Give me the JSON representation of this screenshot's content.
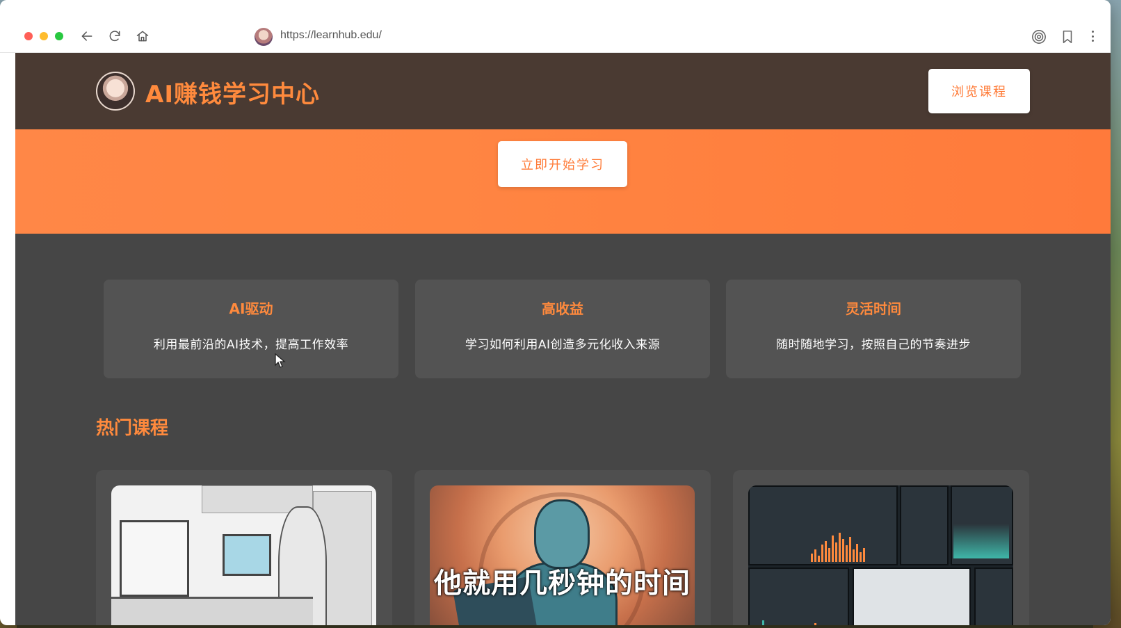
{
  "browser": {
    "url": "https://learnhub.edu/"
  },
  "site": {
    "title": "AI赚钱学习中心",
    "browse_button": "浏览课程",
    "start_button": "立即开始学习"
  },
  "features": [
    {
      "title": "AI驱动",
      "desc": "利用最前沿的AI技术，提高工作效率"
    },
    {
      "title": "高收益",
      "desc": "学习如何利用AI创造多元化收入来源"
    },
    {
      "title": "灵活时间",
      "desc": "随时随地学习，按照自己的节奏进步"
    }
  ],
  "popular": {
    "title": "热门课程"
  },
  "video_subtitle": "他就用几秒钟的时间",
  "colors": {
    "accent": "#ff8a3d",
    "hero": "#ff8747",
    "header_bg": "#4a3a32",
    "page_bg": "#464646",
    "card_bg": "#535353"
  },
  "icons": [
    "back-arrow-icon",
    "reload-icon",
    "home-icon",
    "spiral-icon",
    "bookmark-icon",
    "more-vertical-icon"
  ]
}
